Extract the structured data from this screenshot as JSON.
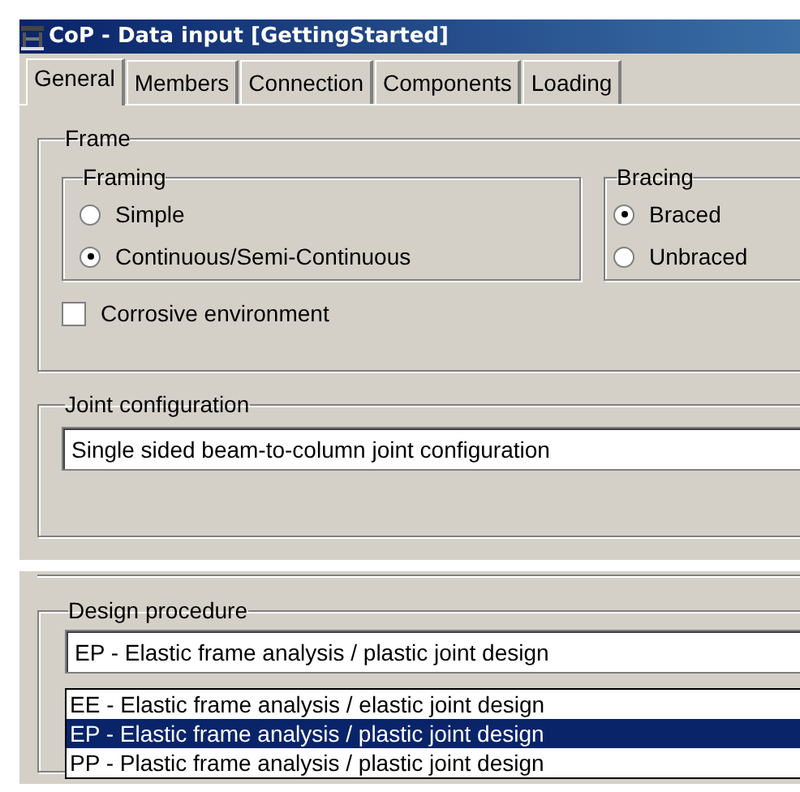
{
  "window": {
    "title": "CoP - Data input [GettingStarted]"
  },
  "tabs": [
    {
      "label": "General",
      "selected": true
    },
    {
      "label": "Members",
      "selected": false
    },
    {
      "label": "Connection",
      "selected": false
    },
    {
      "label": "Components",
      "selected": false
    },
    {
      "label": "Loading",
      "selected": false
    }
  ],
  "frame": {
    "title": "Frame",
    "groups": [
      {
        "title": "Framing",
        "options": [
          {
            "label": "Simple",
            "selected": false
          },
          {
            "label": "Continuous/Semi-Continuous",
            "selected": true
          }
        ]
      },
      {
        "title": "Bracing",
        "options": [
          {
            "label": "Braced",
            "selected": true
          },
          {
            "label": "Unbraced",
            "selected": false
          }
        ]
      }
    ],
    "corrosive": {
      "label": "Corrosive environment",
      "checked": false
    }
  },
  "joint_configuration": {
    "title": "Joint configuration",
    "value": "Single sided beam-to-column joint configuration"
  },
  "design_procedure": {
    "title": "Design procedure",
    "value": "EP - Elastic frame analysis / plastic joint design",
    "options": [
      {
        "label": "EE - Elastic frame analysis / elastic joint design",
        "selected": false
      },
      {
        "label": "EP - Elastic frame analysis / plastic joint design",
        "selected": true
      },
      {
        "label": "PP - Plastic frame analysis / plastic joint design",
        "selected": false
      }
    ]
  }
}
